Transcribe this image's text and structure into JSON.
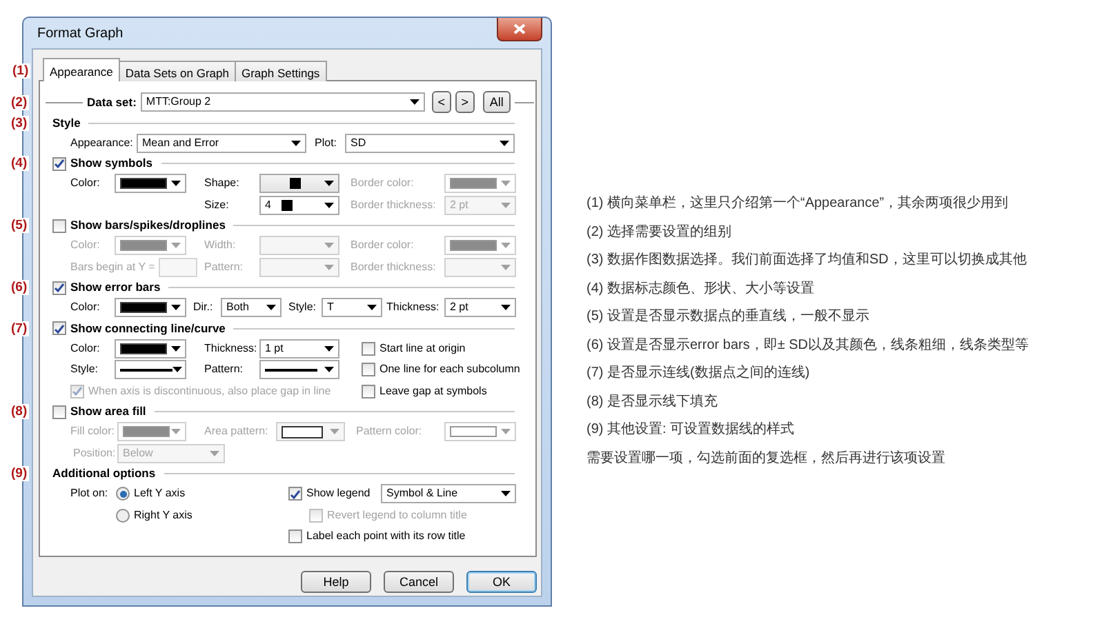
{
  "window": {
    "title": "Format Graph"
  },
  "tabs_marker": "(1)",
  "tabs": [
    {
      "label": "Appearance",
      "selected": true
    },
    {
      "label": "Data Sets on Graph",
      "selected": false
    },
    {
      "label": "Graph Settings",
      "selected": false
    }
  ],
  "data_set": {
    "marker": "(2)",
    "label": "Data set:",
    "value": "MTT:Group 2",
    "prev": "<",
    "next": ">",
    "all": "All"
  },
  "sections": [
    {
      "marker": "(3)",
      "kind": "heading",
      "title": "Style",
      "rows": [
        [
          {
            "kind": "label",
            "text": "Appearance:",
            "disabled": false
          },
          {
            "kind": "select",
            "value": "Mean and Error",
            "disabled": false
          },
          {
            "kind": "label",
            "text": "Plot:",
            "disabled": false
          },
          {
            "kind": "select",
            "value": "SD",
            "disabled": false
          }
        ]
      ]
    },
    {
      "marker": "(4)",
      "kind": "checkbox",
      "title": "Show symbols",
      "checked": true,
      "rows": [
        [
          {
            "kind": "label",
            "text": "Color:",
            "disabled": false
          },
          {
            "kind": "swatch",
            "color": "#000000",
            "disabled": false
          },
          {
            "kind": "label",
            "text": "Shape:",
            "disabled": false
          },
          {
            "kind": "shape-select",
            "disabled": false
          },
          {
            "kind": "label",
            "text": "Border color:",
            "disabled": true
          },
          {
            "kind": "swatch",
            "color": "#8c8c8c",
            "disabled": true
          }
        ],
        [
          "",
          "",
          {
            "kind": "label",
            "text": "Size:",
            "disabled": false
          },
          {
            "kind": "size-select",
            "value": "4",
            "disabled": false
          },
          {
            "kind": "label",
            "text": "Border thickness:",
            "disabled": true
          },
          {
            "kind": "select",
            "value": "2 pt",
            "disabled": true
          }
        ]
      ]
    },
    {
      "marker": "(5)",
      "kind": "checkbox",
      "title": "Show bars/spikes/droplines",
      "checked": false,
      "rows": [
        [
          {
            "kind": "label",
            "text": "Color:",
            "disabled": true
          },
          {
            "kind": "swatch",
            "color": "#8c8c8c",
            "disabled": true
          },
          {
            "kind": "label",
            "text": "Width:",
            "disabled": true
          },
          {
            "kind": "select",
            "disabled": true
          },
          {
            "kind": "label",
            "text": "Border color:",
            "disabled": true
          },
          {
            "kind": "swatch",
            "color": "#8c8c8c",
            "disabled": true
          }
        ],
        [
          {
            "kind": "label",
            "text": "Bars begin at Y =",
            "disabled": true
          },
          {
            "kind": "input",
            "disabled": true
          },
          {
            "kind": "label",
            "text": "Pattern:",
            "disabled": true
          },
          {
            "kind": "select",
            "disabled": true
          },
          {
            "kind": "label",
            "text": "Border thickness:",
            "disabled": true
          },
          {
            "kind": "select",
            "disabled": true
          }
        ]
      ]
    },
    {
      "marker": "(6)",
      "kind": "checkbox",
      "title": "Show error bars",
      "checked": true,
      "rows": [
        [
          {
            "kind": "label",
            "text": "Color:",
            "disabled": false
          },
          {
            "kind": "swatch",
            "color": "#000000",
            "disabled": false
          },
          {
            "kind": "label",
            "text": "Dir.:",
            "disabled": false
          },
          {
            "kind": "select",
            "value": "Both",
            "disabled": false
          },
          {
            "kind": "label",
            "text": "Style:",
            "disabled": false
          },
          {
            "kind": "select",
            "value": "T",
            "disabled": false
          },
          {
            "kind": "label",
            "text": "Thickness:",
            "disabled": false
          },
          {
            "kind": "select",
            "value": "2 pt",
            "disabled": false
          }
        ]
      ]
    },
    {
      "marker": "(7)",
      "kind": "checkbox",
      "title": "Show connecting line/curve",
      "checked": true,
      "rows": [
        [
          {
            "kind": "label",
            "text": "Color:",
            "disabled": false
          },
          {
            "kind": "swatch",
            "color": "#000000",
            "disabled": false
          },
          {
            "kind": "label",
            "text": "Thickness:",
            "disabled": false
          },
          {
            "kind": "select",
            "value": "1 pt",
            "disabled": false
          },
          {
            "kind": "check",
            "text": "Start line at origin",
            "checked": false,
            "disabled": false
          }
        ],
        [
          {
            "kind": "label",
            "text": "Style:",
            "disabled": false
          },
          {
            "kind": "line-select",
            "disabled": false
          },
          {
            "kind": "label",
            "text": "Pattern:",
            "disabled": false
          },
          {
            "kind": "line-select",
            "disabled": false
          },
          {
            "kind": "check",
            "text": "One line for each subcolumn",
            "checked": false,
            "disabled": false
          }
        ],
        [
          {
            "kind": "check",
            "text": "When axis is discontinuous, also place gap in line",
            "checked": true,
            "disabled": true
          },
          {
            "kind": "check",
            "text": "Leave gap at symbols",
            "checked": false,
            "disabled": false
          }
        ]
      ]
    },
    {
      "marker": "(8)",
      "kind": "checkbox",
      "title": "Show area fill",
      "checked": false,
      "rows": [
        [
          {
            "kind": "label",
            "text": "Fill color:",
            "disabled": true
          },
          {
            "kind": "swatch",
            "color": "#8c8c8c",
            "disabled": true
          },
          {
            "kind": "label",
            "text": "Area pattern:",
            "disabled": true
          },
          {
            "kind": "pattern-select",
            "disabled": true
          },
          {
            "kind": "label",
            "text": "Pattern color:",
            "disabled": true
          },
          {
            "kind": "swatch",
            "color": "#ffffff",
            "disabled": true
          }
        ],
        [
          {
            "kind": "label",
            "text": "Position:",
            "disabled": true
          },
          {
            "kind": "select",
            "value": "Below",
            "disabled": true
          }
        ]
      ]
    },
    {
      "marker": "(9)",
      "kind": "heading",
      "title": "Additional options",
      "rows": [
        [
          {
            "kind": "label",
            "text": "Plot on:",
            "disabled": false
          },
          {
            "kind": "radio",
            "text": "Left Y axis",
            "selected": true,
            "disabled": false
          },
          {
            "kind": "check",
            "text": "Show legend",
            "checked": true,
            "disabled": false
          },
          {
            "kind": "select",
            "value": "Symbol & Line",
            "disabled": false
          }
        ],
        [
          "",
          {
            "kind": "radio",
            "text": "Right  Y axis",
            "selected": false,
            "disabled": false
          },
          {
            "kind": "check",
            "text": "Revert legend to column title",
            "checked": false,
            "disabled": true
          }
        ],
        [
          "",
          "",
          {
            "kind": "check",
            "text": "Label each point with its row title",
            "checked": false,
            "disabled": false
          }
        ]
      ]
    }
  ],
  "buttons": [
    {
      "label": "Help",
      "default": false
    },
    {
      "label": "Cancel",
      "default": false
    },
    {
      "label": "OK",
      "default": true
    }
  ],
  "notes": [
    "(1) 横向菜单栏，这里只介绍第一个“Appearance”，其余两项很少用到",
    "(2) 选择需要设置的组别",
    "(3) 数据作图数据选择。我们前面选择了均值和SD，这里可以切换成其他",
    "(4) 数据标志颜色、形状、大小等设置",
    "(5) 设置是否显示数据点的垂直线，一般不显示",
    "(6) 设置是否显示error bars，即± SD以及其颜色，线条粗细，线条类型等",
    "(7) 是否显示连线(数据点之间的连线)",
    "(8) 是否显示线下填充",
    "(9) 其他设置: 可设置数据线的样式",
    "需要设置哪一项，勾选前面的复选框，然后再进行该项设置"
  ]
}
